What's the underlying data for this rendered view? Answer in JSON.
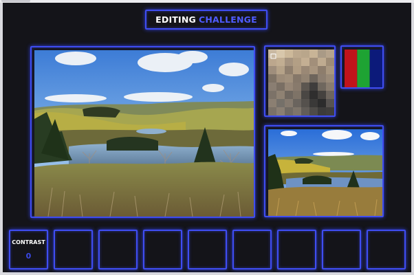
{
  "header": {
    "title_part1": "EDITING",
    "title_part2": "CHALLENGE"
  },
  "swatch": {
    "colors": [
      "#c0131b",
      "#1ea333",
      "#0c1a7a"
    ]
  },
  "stats": {
    "slots": [
      {
        "label": "CONTRAST",
        "value": "0"
      },
      {
        "label": "",
        "value": ""
      },
      {
        "label": "",
        "value": ""
      },
      {
        "label": "",
        "value": ""
      },
      {
        "label": "",
        "value": ""
      },
      {
        "label": "",
        "value": ""
      },
      {
        "label": "",
        "value": ""
      },
      {
        "label": "",
        "value": ""
      },
      {
        "label": "",
        "value": ""
      }
    ]
  },
  "theme": {
    "accent": "#3f4df2",
    "background": "#141419"
  }
}
